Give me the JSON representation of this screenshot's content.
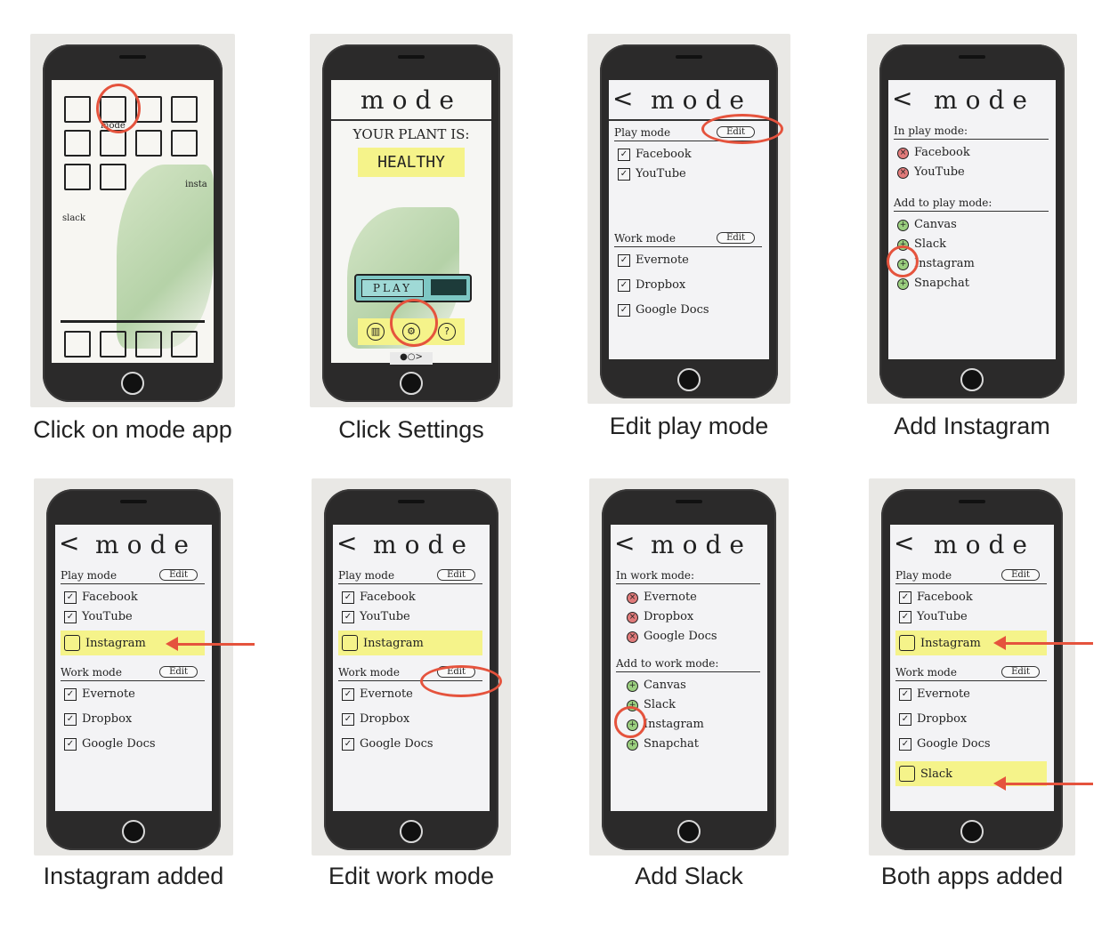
{
  "panels": [
    {
      "caption": "Click on mode app"
    },
    {
      "caption": "Click Settings"
    },
    {
      "caption": "Edit play mode"
    },
    {
      "caption": "Add Instagram"
    },
    {
      "caption": "Instagram added"
    },
    {
      "caption": "Edit work mode"
    },
    {
      "caption": "Add Slack"
    },
    {
      "caption": "Both apps added"
    }
  ],
  "home": {
    "mode_label": "mode",
    "insta_label": "insta",
    "slack_label": "slack"
  },
  "settings": {
    "title": "mode",
    "plant_line": "YOUR PLANT IS:",
    "status": "HEALTHY",
    "play": "PLAY",
    "dots": "●○>"
  },
  "app": {
    "title": "mode",
    "play_mode": "Play mode",
    "work_mode": "Work mode",
    "edit": "Edit",
    "in_play_mode": "In play mode:",
    "add_to_play_mode": "Add to play mode:",
    "in_work_mode": "In work mode:",
    "add_to_work_mode": "Add to work mode:",
    "facebook": "Facebook",
    "youtube": "YouTube",
    "evernote": "Evernote",
    "dropbox": "Dropbox",
    "google_docs": "Google Docs",
    "canvas": "Canvas",
    "slack": "Slack",
    "instagram": "Instagram",
    "snapchat": "Snapchat",
    "back": "<",
    "check": "✓",
    "plus": "+",
    "minus": "×"
  },
  "colors": {
    "accent": "#e5533d",
    "sticky": "#f5f38a",
    "play_teal": "#7dc7c4"
  }
}
